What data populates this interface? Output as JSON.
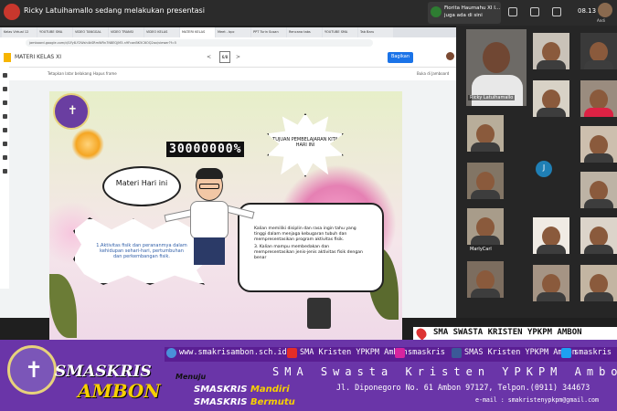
{
  "meeting": {
    "presenter_title": "Ricky Latuihamallo sedang melakukan presentasi",
    "notification_name": "Fiorita Haumahu XI I...",
    "notification_text": "juga ada di sini",
    "clock": "08.13",
    "self_name": "Andi"
  },
  "browser": {
    "tabs": [
      "Kelas Virtual 12",
      "YOUTUBE SMA",
      "VIDEO TANGGAL",
      "VIDEO TRANSI",
      "VIDEO KELAS",
      "MATERI KELAS",
      "Meet - bpc",
      "PPT Turin Susan",
      "Rencana tabs",
      "YOUTUBE SMA",
      "Tab Baru"
    ],
    "url": "jamboard.google.com/d/1Fy8-Y2Wsh4kSRmWRn7N8EQjM3-n9FcanBK5C6OQ2ax/viewer?f=5"
  },
  "jamboard": {
    "title": "MATERI KELAS XI",
    "nav_prev": "<",
    "nav_next": ">",
    "frame_num": "6/8",
    "share_label": "Bagikan",
    "set_background": "Tetapkan latar belakang",
    "clear_frame": "Hapus frame",
    "open_jamboard": "Buka di Jamboard"
  },
  "slide": {
    "counter": "30000000%",
    "bubble_today": "Materi Hari ini",
    "bubble_goal": "TUJUAN PEMBELAJARAN KITA HARI INI",
    "bubble_topics": "1.Aktivitas fisik dan perananmya dalam kehidupan sehari-hari, pertumbuhan dan perkembangan fisik.",
    "goal_paragraph_1": "Kalian memiliki disiplin dan rasa ingin tahu yang tinggi dalam menjaga kebugaran tubuh dan mempresentasikan program aktivitas fisik.",
    "goal_paragraph_2": "3. Kalian mampu membedakan dan mempresentasikan jenis-jenis aktivitas fisik dengan benar"
  },
  "gallery": {
    "pinned_name": "Ricky Latuihamallo",
    "initial": "J",
    "tile_name": "MarlyCarl"
  },
  "banner": {
    "location": "SMA SWASTA KRISTEN YPKPM AMBON",
    "brand_line1": "SMASKRIS",
    "brand_line2": "AMBON",
    "website": "www.smakrisambon.sch.id",
    "youtube": "SMA Kristen YPKPM Ambon",
    "instagram": "smaskris",
    "facebook": "SMAS Kristen YPKPM Ambon",
    "twitter": "smaskris",
    "menuju": "Menuju",
    "motto1_a": "SMASKRIS",
    "motto1_b": "Mandiri",
    "motto2_a": "SMASKRIS",
    "motto2_b": "Bermutu",
    "school_name": "SMA Swasta Kristen YPKPM Ambon",
    "address": "Jl. Diponegoro No. 61 Ambon 97127, Telpon.(0911) 344673",
    "email": "e-mail : smakristenypkpm@gmail.com"
  },
  "colors": {
    "banner_bg": "#6a35a8",
    "brand_yellow": "#f7d000",
    "share_blue": "#1a73e8"
  }
}
